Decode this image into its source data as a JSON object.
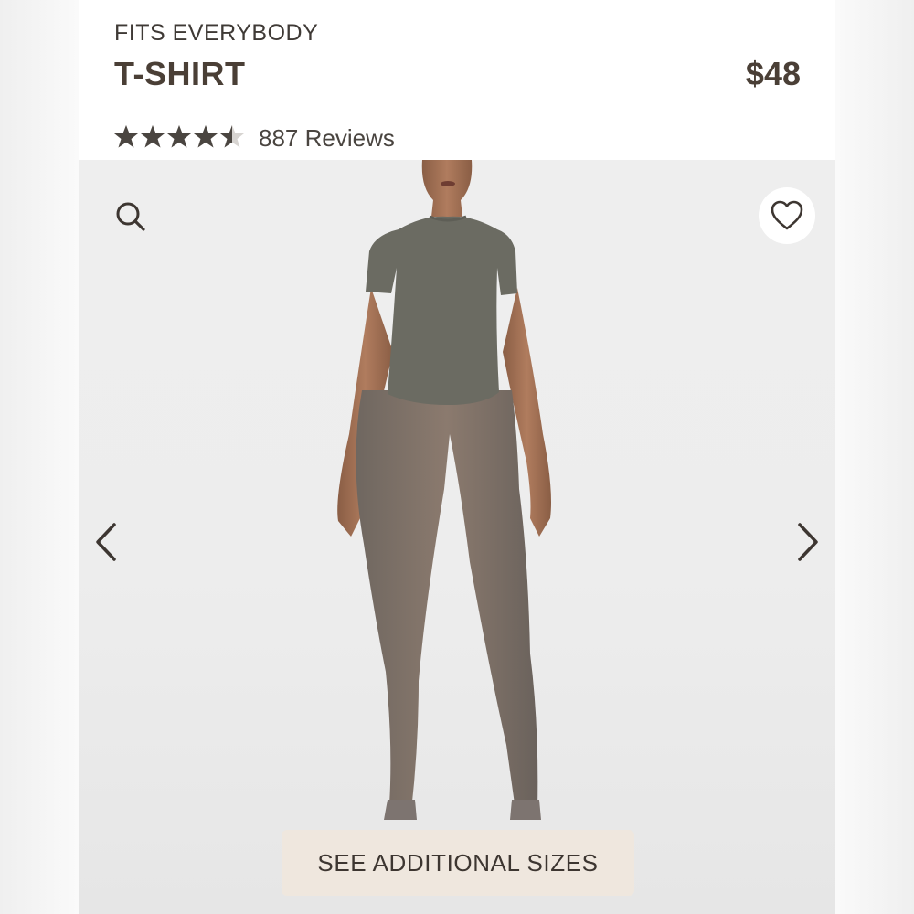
{
  "product": {
    "collection": "FITS EVERYBODY",
    "title": "T-SHIRT",
    "price": "$48"
  },
  "rating": {
    "stars": 4.5,
    "max_stars": 5,
    "reviews_label": "887 Reviews"
  },
  "gallery": {
    "search_icon": "search-icon",
    "favorite_icon": "heart-outline-icon",
    "prev_icon": "chevron-left-icon",
    "next_icon": "chevron-right-icon",
    "additional_sizes_label": "SEE ADDITIONAL SIZES"
  },
  "colors": {
    "title": "#4a3f36",
    "star": "#4a4540",
    "button_bg": "#efe7de",
    "garment": "#6b6b62"
  }
}
